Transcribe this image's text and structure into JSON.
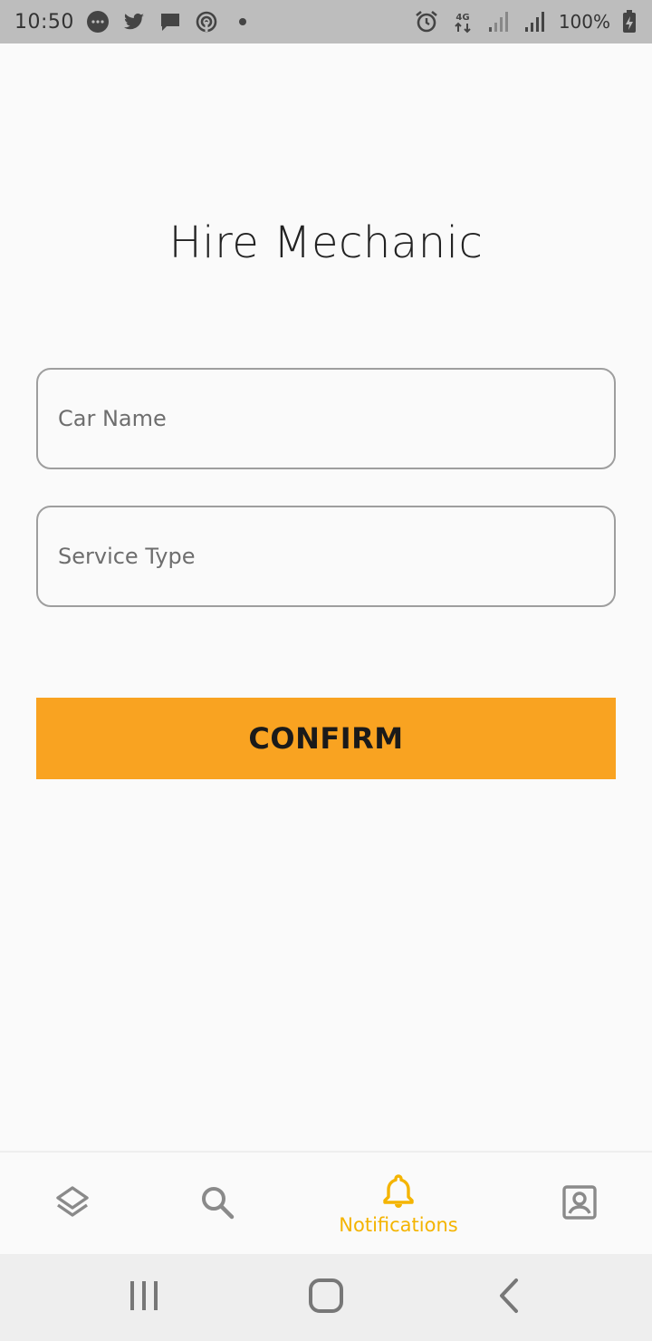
{
  "status_bar": {
    "time": "10:50",
    "battery": "100%",
    "network": "4G",
    "icons_left": [
      "messenger-icon",
      "twitter-icon",
      "chat-icon",
      "hotspot-icon",
      "dot-icon"
    ],
    "icons_right": [
      "alarm-icon",
      "network-4g-icon",
      "signal-icon",
      "signal-icon",
      "battery-charging-icon"
    ]
  },
  "page": {
    "title": "Hire Mechanic"
  },
  "form": {
    "car_name": {
      "placeholder": "Car Name",
      "value": ""
    },
    "service_type": {
      "placeholder": "Service Type",
      "value": ""
    },
    "confirm_label": "CONFIRM"
  },
  "bottom_nav": {
    "items": [
      {
        "icon": "layers-icon",
        "label": "",
        "active": false
      },
      {
        "icon": "search-icon",
        "label": "",
        "active": false
      },
      {
        "icon": "bell-icon",
        "label": "Notifications",
        "active": true
      },
      {
        "icon": "profile-icon",
        "label": "",
        "active": false
      }
    ]
  },
  "system_nav": {
    "buttons": [
      "recent-apps-icon",
      "home-icon",
      "back-icon"
    ]
  },
  "colors": {
    "accent": "#f9a321",
    "active_nav": "#f4b400",
    "inactive_icon": "#8a8a8a",
    "status_bar": "#bdbdbd"
  }
}
